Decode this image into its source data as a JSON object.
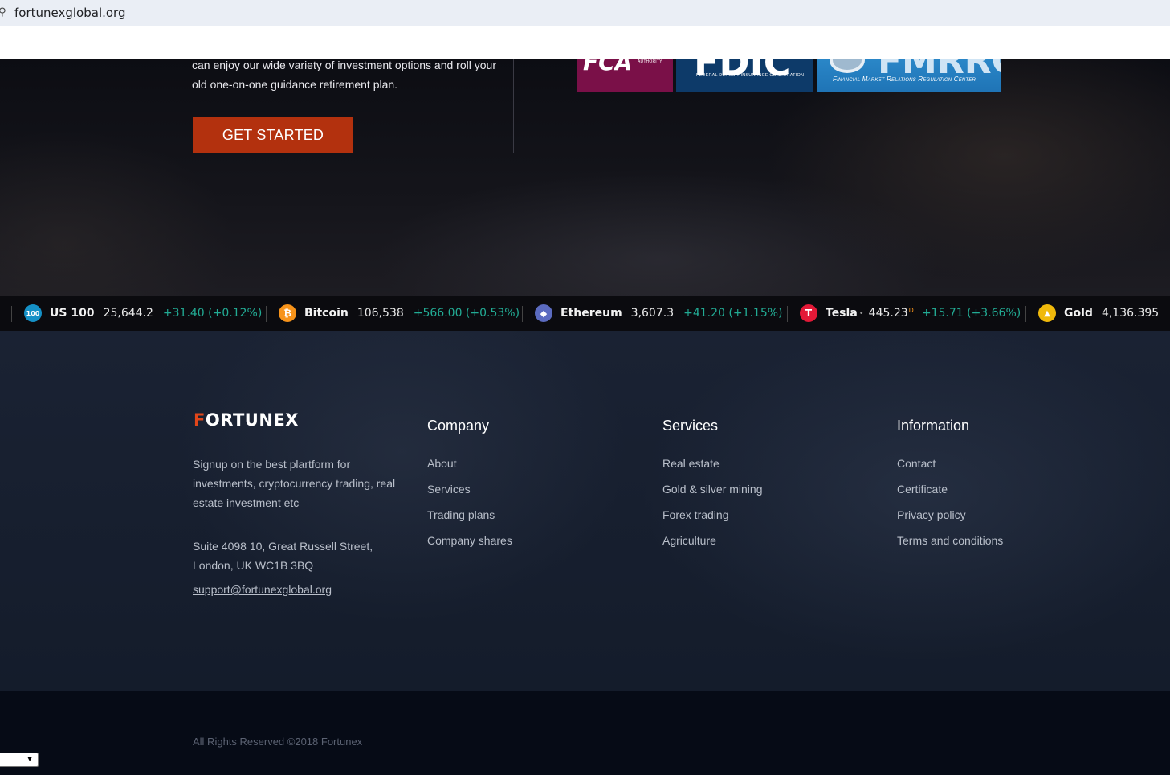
{
  "browser": {
    "url": "fortunexglobal.org"
  },
  "hero": {
    "text": "can enjoy our wide variety of investment options and roll your old one-on-one guidance retirement plan.",
    "cta_label": "GET STARTED",
    "logos": {
      "fca_small": "AUTHORITY",
      "fdic_big": "FDIC",
      "fdic_small": "FEDERAL DEPOSIT INSURANCE CORPORATION",
      "fmrrc_big": "FMRRC",
      "fmrrc_small": "Financial Market Relations Regulation Center"
    },
    "colors": {
      "cta": "#b3310e",
      "fca": "#7a1048",
      "fdic": "#0d3a69",
      "fmrrc": "#2a87c8"
    }
  },
  "ticker": [
    {
      "icon": "us100-icon",
      "badge": "100",
      "name": "US 100",
      "price": "25,644.2",
      "change": "+31.40 (+0.12%)",
      "color": "#1591c7"
    },
    {
      "icon": "bitcoin-icon",
      "badge": "₿",
      "name": "Bitcoin",
      "price": "106,538",
      "change": "+566.00 (+0.53%)",
      "color": "#f7931a"
    },
    {
      "icon": "ethereum-icon",
      "badge": "◆",
      "name": "Ethereum",
      "price": "3,607.3",
      "change": "+41.20 (+1.15%)",
      "color": "#5b6bc0"
    },
    {
      "icon": "tesla-icon",
      "badge": "T",
      "name": "Tesla",
      "price": "445.23",
      "sup": "D",
      "change": "+15.71 (+3.66%)",
      "color": "#e31937"
    },
    {
      "icon": "gold-icon",
      "badge": "▲",
      "name": "Gold",
      "price": "4,136.395",
      "change": "",
      "color": "#f0b90b"
    }
  ],
  "footer": {
    "brand": "FORTUNEX",
    "brand_f": "F",
    "brand_rest": "ORTUNEX",
    "description": "Signup on the best plartform for investments, cryptocurrency trading, real estate investment etc",
    "address": "Suite 4098 10, Great Russell Street, London, UK WC1B 3BQ",
    "email": "support@fortunexglobal.org",
    "company": {
      "title": "Company",
      "links": [
        "About",
        "Services",
        "Trading plans",
        "Company shares"
      ]
    },
    "services": {
      "title": "Services",
      "links": [
        "Real estate",
        "Gold & silver mining",
        "Forex trading",
        "Agriculture"
      ]
    },
    "information": {
      "title": "Information",
      "links": [
        "Contact",
        "Certificate",
        "Privacy policy",
        "Terms and conditions"
      ]
    },
    "copyright": "All Rights Reserved ©2018 Fortunex"
  }
}
